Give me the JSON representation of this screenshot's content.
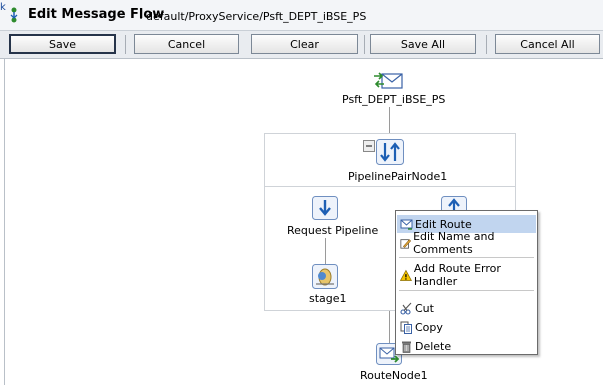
{
  "window": {
    "title": "Edit Message Flow",
    "title_separator": ":",
    "path": "default/ProxyService/Psft_DEPT_iBSE_PS",
    "back_glyph": "k"
  },
  "toolbar": {
    "save_label": "Save",
    "cancel_label": "Cancel",
    "clear_label": "Clear",
    "save_all_label": "Save All",
    "cancel_all_label": "Cancel All"
  },
  "flow": {
    "service_node": {
      "label": "Psft_DEPT_iBSE_PS",
      "icon": "proxy-service-icon"
    },
    "pipeline_pair": {
      "label": "PipelinePairNode1",
      "icon": "pipeline-pair-icon"
    },
    "request_pipeline": {
      "label": "Request Pipeline",
      "icon": "down-arrow-icon"
    },
    "stage": {
      "label": "stage1",
      "icon": "stage-icon"
    },
    "route_node": {
      "label": "RouteNode1",
      "icon": "route-envelope-icon"
    }
  },
  "context_menu": {
    "items": [
      {
        "label": "Edit Route",
        "icon": "edit-route-icon",
        "selected": true
      },
      {
        "label": "Edit Name and Comments",
        "icon": "edit-comment-icon"
      },
      {
        "label": "Add Route Error Handler",
        "icon": "warning-icon"
      },
      {
        "label": "Cut",
        "icon": "scissors-icon"
      },
      {
        "label": "Copy",
        "icon": "copy-icon"
      },
      {
        "label": "Delete",
        "icon": "trash-icon"
      }
    ]
  },
  "colors": {
    "selection": "#c1d5ef",
    "title_bar": "#f3f5f8",
    "toolbar": "#e9ecf0"
  }
}
